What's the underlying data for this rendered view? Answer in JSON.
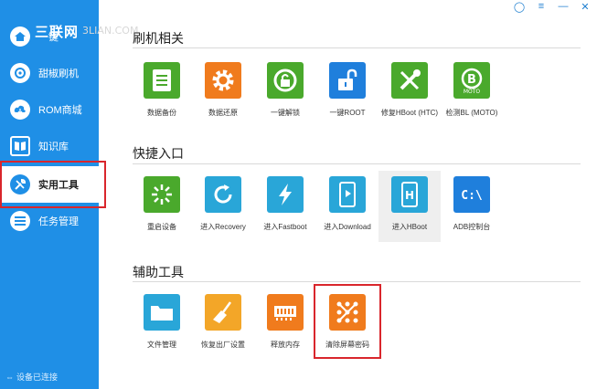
{
  "watermark": {
    "text": "三联网",
    "url": "3LIAN.COM"
  },
  "sidebar": {
    "items": [
      {
        "label": "一键"
      },
      {
        "label": "甜椒刷机"
      },
      {
        "label": "ROM商城"
      },
      {
        "label": "知识库"
      },
      {
        "label": "实用工具"
      },
      {
        "label": "任务管理"
      }
    ],
    "status": "设备已连接"
  },
  "window_controls": {
    "feedback": "◯",
    "menu": "≡",
    "minimize": "—",
    "close": "✕"
  },
  "sections": [
    {
      "title": "刷机相关",
      "tiles": [
        {
          "label": "数据备份",
          "icon": "clipboard-icon",
          "color": "#4aa92c"
        },
        {
          "label": "数据还原",
          "icon": "gear-icon",
          "color": "#f07b1d"
        },
        {
          "label": "一键解锁",
          "icon": "unlock-circle-icon",
          "color": "#4aa92c"
        },
        {
          "label": "一键ROOT",
          "icon": "padlock-icon",
          "color": "#1f7fdc"
        },
        {
          "label": "修复HBoot (HTC)",
          "icon": "wrench-screwdriver-icon",
          "color": "#4aa92c"
        },
        {
          "label": "检测BL (MOTO)",
          "icon": "bl-check-icon",
          "color": "#4aa92c"
        }
      ]
    },
    {
      "title": "快捷入口",
      "tiles": [
        {
          "label": "重启设备",
          "icon": "restart-icon",
          "color": "#4aa92c"
        },
        {
          "label": "进入Recovery",
          "icon": "recovery-icon",
          "color": "#29a6d8"
        },
        {
          "label": "进入Fastboot",
          "icon": "lightning-icon",
          "color": "#29a6d8"
        },
        {
          "label": "进入Download",
          "icon": "download-phone-icon",
          "color": "#29a6d8"
        },
        {
          "label": "进入HBoot",
          "icon": "hboot-phone-icon",
          "color": "#29a6d8"
        },
        {
          "label": "ADB控制台",
          "icon": "terminal-icon",
          "color": "#1f7fdc"
        }
      ]
    },
    {
      "title": "辅助工具",
      "tiles": [
        {
          "label": "文件管理",
          "icon": "folder-icon",
          "color": "#29a6d8"
        },
        {
          "label": "恢复出厂设置",
          "icon": "broom-icon",
          "color": "#f3a628"
        },
        {
          "label": "释放内存",
          "icon": "memory-icon",
          "color": "#f07b1d"
        },
        {
          "label": "清除屏幕密码",
          "icon": "pattern-lock-icon",
          "color": "#f07b1d"
        }
      ]
    }
  ]
}
